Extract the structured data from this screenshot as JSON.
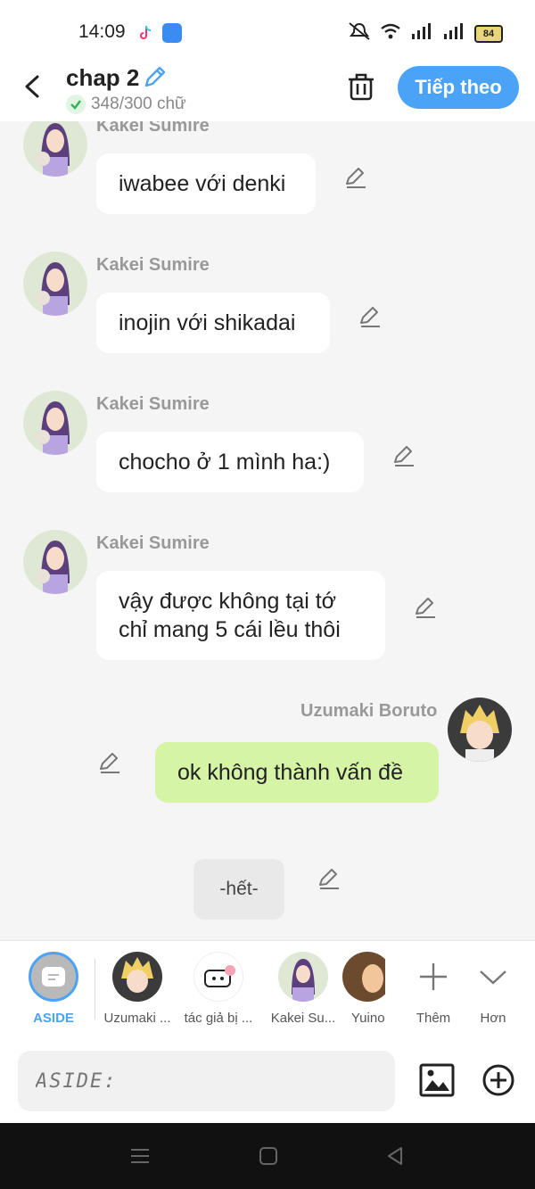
{
  "status_bar": {
    "time": "14:09",
    "battery": "84"
  },
  "header": {
    "title": "chap 2",
    "word_count": "348/300 chữ",
    "next_button": "Tiếp theo"
  },
  "messages": [
    {
      "sender": "Kakei Sumire",
      "text": "iwabee với denki"
    },
    {
      "sender": "Kakei Sumire",
      "text": "inojin với shikadai"
    },
    {
      "sender": "Kakei Sumire",
      "text": "chocho ở 1 mình ha:)"
    },
    {
      "sender": "Kakei Sumire",
      "text_line1": "vậy được không tại tớ",
      "text_line2": "chỉ mang 5 cái lều thôi"
    },
    {
      "sender": "Uzumaki Boruto",
      "text": "ok không thành vấn đề"
    }
  ],
  "aside_message": {
    "text": "-hết-"
  },
  "character_bar": {
    "aside_label": "ASIDE",
    "characters": [
      {
        "label": "Uzumaki ..."
      },
      {
        "label": "tác giả bị ..."
      },
      {
        "label": "Kakei Su..."
      },
      {
        "label": "Yuino"
      }
    ],
    "add_label": "Thêm",
    "more_label": "Hơn"
  },
  "input": {
    "placeholder": "ASIDE:"
  },
  "colors": {
    "accent": "#4ba3f7",
    "green_bubble": "#d5f4a5",
    "aside_active": "#4ba3f7"
  }
}
